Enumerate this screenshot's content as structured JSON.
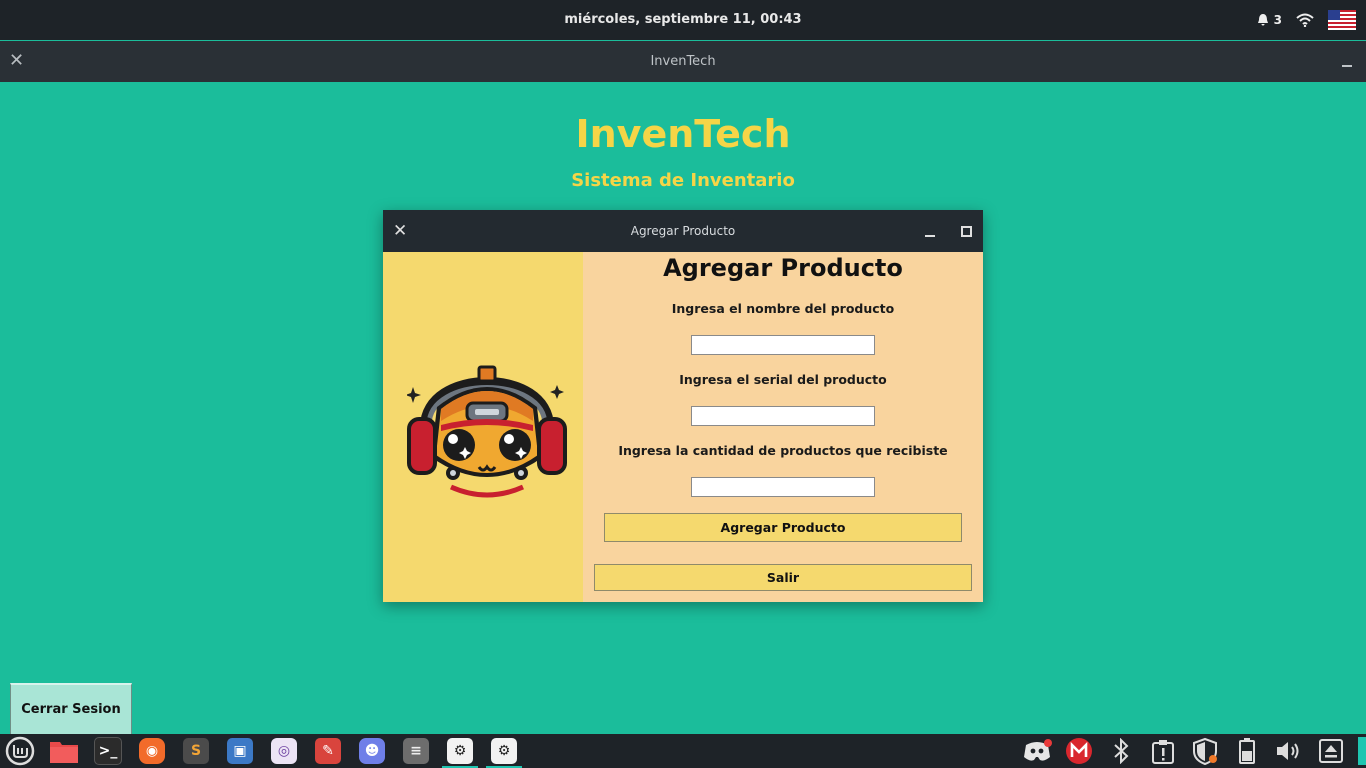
{
  "top_panel": {
    "clock": "miércoles, septiembre 11, 00:43",
    "notification_count": "3"
  },
  "main_window": {
    "title": "InvenTech",
    "app_title": "InvenTech",
    "app_subtitle": "Sistema de Inventario",
    "logout_button": "Cerrar Sesion"
  },
  "dialog": {
    "title": "Agregar Producto",
    "heading": "Agregar Producto",
    "name_label": "Ingresa el nombre del producto",
    "serial_label": "Ingresa el serial del producto",
    "quantity_label": "Ingresa la cantidad de productos que recibiste",
    "name_value": "",
    "serial_value": "",
    "quantity_value": "",
    "add_button": "Agregar Producto",
    "exit_button": "Salir"
  },
  "colors": {
    "background": "#1bbd9b",
    "accent_yellow": "#f5d547",
    "dialog_body": "#f9d49e",
    "side_panel": "#f5d96e"
  },
  "taskbar": {
    "left_icons": [
      "mint-menu-icon",
      "files-icon",
      "terminal-icon",
      "firefox-icon",
      "sublime-icon",
      "screenshot-icon",
      "webcam-icon",
      "gimp-icon",
      "discord-icon",
      "database-icon",
      "settings-icon",
      "settings-icon"
    ],
    "right_icons": [
      "discord-tray-icon",
      "mega-icon",
      "bluetooth-icon",
      "update-icon",
      "shield-icon",
      "battery-icon",
      "volume-icon",
      "eject-icon"
    ]
  }
}
